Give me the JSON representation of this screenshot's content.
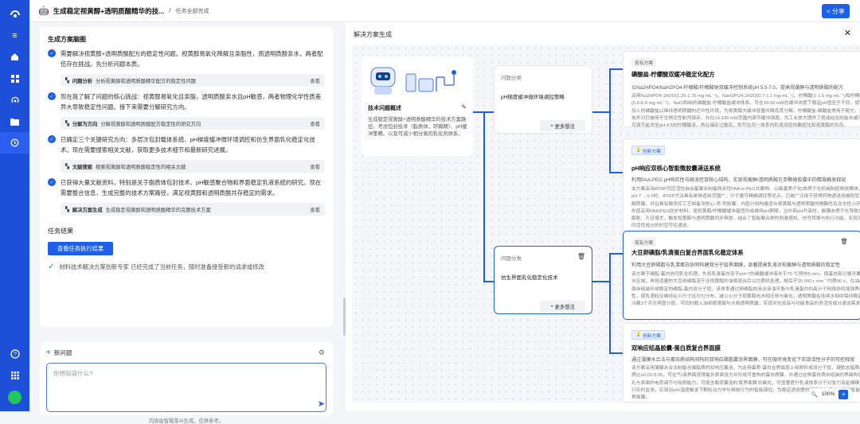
{
  "header": {
    "title": "生成稳定视黄醇+透明质酸精华的技...",
    "separator": "/",
    "status": "任务全部完成",
    "share_label": "分享"
  },
  "plan": {
    "title": "生成方案脑图",
    "steps": [
      {
        "text": "需要解决视黄醇+透明质酸配方的稳定性问题。视黄醇易氧化降解且亲脂性，而透明质酸亲水，两者配伍存在挑战。先分析问题本质。",
        "tool_name": "问题分析",
        "tool_desc": "分析视黄醇和透明质酸精华配方的稳定性问题",
        "tool_action": "查看"
      },
      {
        "text": "现在我了解了问题的核心挑战：视黄醇易氧化且亲脂，透明质酸亲水且pH敏感，两者物理化学性质差异大导致稳定性问题。接下来需要分解研究方向。",
        "tool_name": "分解为方向",
        "tool_desc": "分解视黄醇和透明质酸配方稳定性的研究方向",
        "tool_action": "查看"
      },
      {
        "text": "已确定三个关键研究方向：多层次包封载体系统、pH梯度缓冲微环境调控和仿生界面乳化稳定化技术。现在需要搜索相关文献，获取更多技术细节和最新研究进展。",
        "tool_name": "文献搜索",
        "tool_desc": "搜索视黄醇和透明质酸稳定性的相关文献",
        "tool_action": "查看"
      },
      {
        "text": "已获得大量文献资料，特别是关于脂质体包封技术、pH敏感聚合物和界面稳定乳液系统的研究。现在需要整合信息，生成完整的技术方案路径，满足视黄醇和透明质酸共存稳定的需求。",
        "tool_name": "解决方案生成",
        "tool_desc": "生成稳定视黄醇和透明质酸精华的完整技术方案",
        "tool_action": "查看"
      }
    ],
    "result_title": "任务结果",
    "result_button": "查看任务执行结果",
    "done_text": "材料技术解决方案创新专家 已经完成了当前任务，随时准备接受新的请求或修改"
  },
  "question": {
    "new_label": "新问题",
    "placeholder": "你想知道什么?",
    "footer": "内容由智慧芽AI生成，仅供参考。"
  },
  "panel": {
    "title": "解决方案生成",
    "root": {
      "title": "技术问题概述",
      "desc": "生成稳定视黄醇+透明质酸精华的技术方案路径。考虑包封技术（脂质体、环糊精）、pH缓冲策略、以及可减少相分离的乳化剂体系。"
    },
    "branches": [
      {
        "category": "问题分类",
        "text": "pH梯度缓冲微环境调控策略",
        "more": "更多想法"
      },
      {
        "category": "问题分类",
        "text": "仿生界面乳化稳定化技术",
        "more": "更多想法"
      }
    ],
    "leaves": [
      {
        "tag": "现有方案",
        "title": "磷酸盐-柠檬酸双缓冲稳定化配方",
        "line1": "以Na2HPO4/NaH2PO4-柠檬酸/柠檬酸钠双缓冲控制系统pH 5.5-7.0。提高视黄醇与透明质酸的配方",
        "detail": "采用Na2HPO4·2H2O(1.25-1.75 mg·mL⁻¹)、NaH2PO4·2H2O(0.7-1.1 mg·mL⁻¹)、柠檬酸(1-1.5 mg·mL⁻¹)和柠檬酸钠(5.6-6.4 mg·mL⁻¹)，NaCl和纯的磷酸盐-柠檬酸盐缓冲体系。可在10-50 mM总缓冲浓度下稳定pH值至于不同，使需要加入的磷酸盐以维持透明质酸的近中性环境，为视黄醇大缓冲容量并降低其分解，柠檬酸盐-磷酸盐常用于配方，这类技术对已被用于生物活性制剂保存，并在10-100 mM范围内调节缓冲强度。为工业放大提供了现成经验的盐水缓冲pH可调节盐浓至pH 4.5的柠檬酸溶，再在储存过量后，即可在同一体系内形成双层的酯层化和视黄醇的共存。"
      },
      {
        "tag": "创新方案",
        "title": "pH响应双核心智能微胶囊递送系统",
        "line1": "利用PAA-PEG pH响应性与微流控双核心结构，实现视黄醇/透明质酸在单颗微胶囊中的精准触发释放",
        "detail": "本方案采用ATRP可控活性自由基聚合制备两亲性PAA-b-PEG共聚物。以碳基质子化/去质子化机械制层释放模块，在pH 7 →5.5时，ATRP方法具有单体适用范围广、分子量可精确调控等优点，已被广泛用于获得药物递送用嵌段型聚电解质膜，并且具有微流控工艺制备双核心-壳-壳胶囊：内层分别构建适合视黄醇与透明质酸的微酯性及含水性小环境。外层采用PAA/PEG防护材料，使视黄醇/柠檬酸缓冲基团形成维持pH屏障。当外部pH升高时，嵌膜去质子化导致外壳膨胀、孔径增大，触发视黄醇与透明质酸同步释放，结合了智能聚合物的刺激感知、信号转换与执行功能，实现对不同活性成分的时空可控递送。"
      },
      {
        "tag": "现有方案",
        "title": "大豆卵磷脂/乳清蛋白复合界面乳化稳定体系",
        "line1": "利用大豆卵磷脂与乳清蛋白协同构建双分子层界面膜，显著提高乳液对视黄醇与透明质酸的稳定性",
        "detail": "该方案于磷脂-蛋白协同乳化机理，先将乳清蛋白溶于pH≈7的磷酸缓冲液并于70 ℃预热5 min，使蛋白部分展开暴露疏水区域；再将适量的大豆卵磷脂溶于含视黄醇的油相混合后以均质机处理，随后于25 000 r·min⁻¹均质90 s，在油/水界面自组装形成稳定的磷脂-蛋白双分子层。该体系通过卵磷脂的亲水亲油平衡与乳清蛋白的高分子网络协同增强界面弹性，使乳滴粒径维持在小尺寸且均匀分布，减少小分子视黄醇向水相迁移与氧化，透明质酸在连续水相中保持稳定，冷藏3个月无明显分层，可同时载入油相视黄醇与水相透明质酸，实现对化妆品与功能食品的多活性成分递送需求。"
      },
      {
        "tag": "创新方案",
        "title": "双响应结晶胶囊-蛋白质复合界面膜",
        "line1": "通过薄膜水合法与蛋白质结构间构的双响应磷脂囊泡界面膜，可在微环境变化下实现活性分子的可控释放",
        "detail": "该方案采用薄膜水合法制备含磷脂质的双响应囊泡，为此待蛋质-蛋白在界面层上吸附形成双分子层，凝胶态脂质/磷脂质比≥0.02-0.05，可在气/液界面获得最长表面张力并形成可重构的蛋白质膜，并通过这种蛋白质自组装的界面构筑多孔与表面的电荷调节与吸附能力，可使含载荷囊泡的'厚界面膜'抗氧化，可显著提升乳液体系分子对张力及粘弹模量进行实时监测，实现对pH/温度触发下颗粒动力学与释放行为的智能调控，为稳定递送提供接着释放活性分子的智能复合界面膜。"
      }
    ],
    "zoom": "100%"
  },
  "colors": {
    "accent": "#1d5fe6",
    "rail": "#1d4fd8"
  }
}
